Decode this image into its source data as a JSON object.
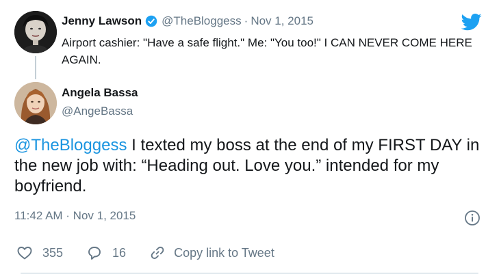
{
  "parent_tweet": {
    "name": "Jenny Lawson",
    "handle": "@TheBloggess",
    "separator": "·",
    "date": "Nov 1, 2015",
    "text": "Airport cashier: \"Have a safe flight.\" Me: \"You too!\"  I CAN NEVER COME HERE AGAIN."
  },
  "reply_tweet": {
    "name": "Angela Bassa",
    "handle": "@AngeBassa",
    "mention": "@TheBloggess",
    "text": " I texted my boss at the end of my FIRST DAY in the new job with: “Heading out. Love you.” intended for my boyfriend.",
    "timestamp": "11:42 AM · Nov 1, 2015"
  },
  "actions": {
    "likes": "355",
    "replies": "16",
    "copy_link": "Copy link to Tweet"
  },
  "icons": {
    "brand": "twitter-bird-icon",
    "verified": "verified-badge-icon",
    "info": "info-icon",
    "like": "heart-icon",
    "reply": "reply-bubble-icon",
    "link": "link-icon"
  },
  "colors": {
    "brand": "#1da1f2",
    "link": "#1b95e0",
    "secondary_text": "#657786"
  }
}
